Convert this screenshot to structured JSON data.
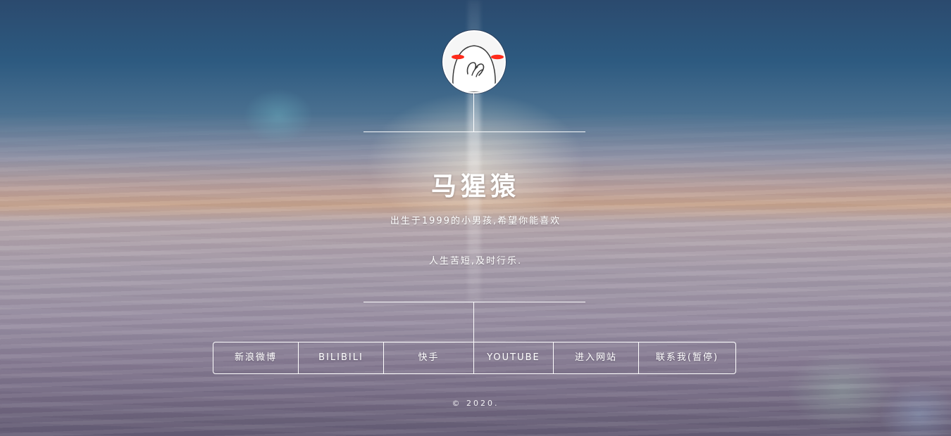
{
  "profile": {
    "avatar_icon": "blushing-face-icon",
    "name": "马猩猿",
    "tagline": "出生于1999的小男孩,希望你能喜欢",
    "motto": "人生苦短,及时行乐."
  },
  "nav": {
    "items": [
      {
        "label": "新浪微博"
      },
      {
        "label": "BILIBILI"
      },
      {
        "label": "快手"
      },
      {
        "label": "YOUTUBE"
      },
      {
        "label": "进入网站"
      },
      {
        "label": "联系我(暂停)"
      }
    ]
  },
  "footer": {
    "copyright": "© 2020."
  },
  "colors": {
    "text": "#ffffff",
    "line": "#ffffff",
    "blush": "#ff2a1a"
  }
}
